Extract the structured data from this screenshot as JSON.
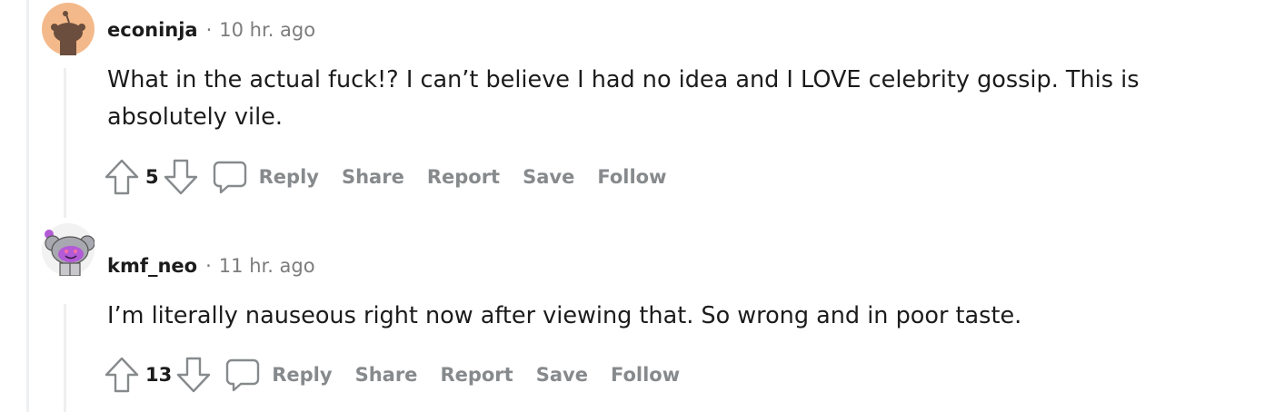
{
  "comments": [
    {
      "author": "econinja",
      "separator": "·",
      "time": "10 hr. ago",
      "text": "What in the actual fuck!? I can’t believe I had no idea and I LOVE celebrity gossip. This is absolutely vile.",
      "score": "5",
      "actions": {
        "reply": "Reply",
        "share": "Share",
        "report": "Report",
        "save": "Save",
        "follow": "Follow"
      }
    },
    {
      "author": "kmf_neo",
      "separator": "·",
      "time": "11 hr. ago",
      "text": "I’m literally nauseous right now after viewing that. So wrong and in poor taste.",
      "score": "13",
      "actions": {
        "reply": "Reply",
        "share": "Share",
        "report": "Report",
        "save": "Save",
        "follow": "Follow"
      }
    }
  ],
  "colors": {
    "text_primary": "#1c1c1c",
    "text_meta": "#7c7c7c",
    "action_gray": "#878a8c",
    "thread_line": "#edeff1",
    "avatar_orange": "#f4b98a",
    "avatar_purple": "#b35ad6"
  },
  "icons": {
    "upvote": "arrow-up-outline",
    "downvote": "arrow-down-outline",
    "reply": "speech-bubble-outline"
  }
}
